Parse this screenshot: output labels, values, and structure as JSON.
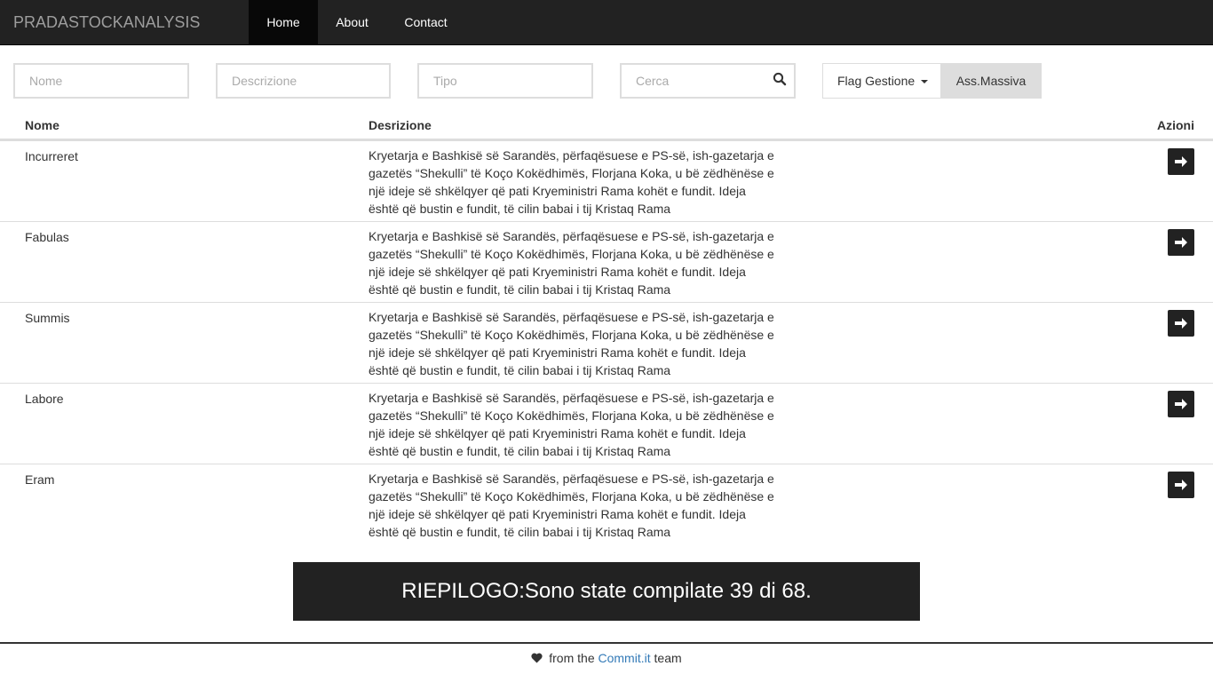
{
  "navbar": {
    "brand": "PRADASTOCKANALYSIS",
    "items": [
      {
        "label": "Home",
        "active": true
      },
      {
        "label": "About",
        "active": false
      },
      {
        "label": "Contact",
        "active": false
      }
    ]
  },
  "filters": {
    "nome_placeholder": "Nome",
    "descrizione_placeholder": "Descrizione",
    "tipo_placeholder": "Tipo",
    "cerca_placeholder": "Cerca",
    "search_icon": "search-icon",
    "flag_label": "Flag Gestione",
    "massiva_label": "Ass.Massiva"
  },
  "table": {
    "headers": {
      "nome": "Nome",
      "descrizione": "Desrizione",
      "azioni": "Azioni"
    },
    "rows": [
      {
        "name": "Incurreret",
        "description": "Kryetarja e Bashkisë së Sarandës, përfaqësuese e PS-së, ish-gazetarja e gazetës “Shekulli” të Koço Kokëdhimës, Florjana Koka, u bë zëdhënëse e një ideje së shkëlqyer që pati Kryeministri Rama kohët e fundit. Ideja është që bustin e fundit, të cilin babai i tij Kristaq Rama",
        "action_icon": "arrow-right-icon"
      },
      {
        "name": "Fabulas",
        "description": "Kryetarja e Bashkisë së Sarandës, përfaqësuese e PS-së, ish-gazetarja e gazetës “Shekulli” të Koço Kokëdhimës, Florjana Koka, u bë zëdhënëse e një ideje së shkëlqyer që pati Kryeministri Rama kohët e fundit. Ideja është që bustin e fundit, të cilin babai i tij Kristaq Rama",
        "action_icon": "arrow-right-icon"
      },
      {
        "name": "Summis",
        "description": "Kryetarja e Bashkisë së Sarandës, përfaqësuese e PS-së, ish-gazetarja e gazetës “Shekulli” të Koço Kokëdhimës, Florjana Koka, u bë zëdhënëse e një ideje së shkëlqyer që pati Kryeministri Rama kohët e fundit. Ideja është që bustin e fundit, të cilin babai i tij Kristaq Rama",
        "action_icon": "arrow-right-icon"
      },
      {
        "name": "Labore",
        "description": "Kryetarja e Bashkisë së Sarandës, përfaqësuese e PS-së, ish-gazetarja e gazetës “Shekulli” të Koço Kokëdhimës, Florjana Koka, u bë zëdhënëse e një ideje së shkëlqyer që pati Kryeministri Rama kohët e fundit. Ideja është që bustin e fundit, të cilin babai i tij Kristaq Rama",
        "action_icon": "arrow-right-icon"
      },
      {
        "name": "Eram",
        "description": "Kryetarja e Bashkisë së Sarandës, përfaqësuese e PS-së, ish-gazetarja e gazetës “Shekulli” të Koço Kokëdhimës, Florjana Koka, u bë zëdhënëse e një ideje së shkëlqyer që pati Kryeministri Rama kohët e fundit. Ideja është që bustin e fundit, të cilin babai i tij Kristaq Rama",
        "action_icon": "arrow-right-icon"
      }
    ]
  },
  "summary": {
    "text": "RIEPILOGO:Sono state compilate 39 di 68."
  },
  "footer": {
    "icon": "heart-icon",
    "prefix": "from the",
    "link": "Commit.it",
    "suffix": "team"
  },
  "colors": {
    "navbar_bg": "#222222",
    "navbar_active": "#080808",
    "link": "#337ab7",
    "summary_bg": "#222222"
  }
}
